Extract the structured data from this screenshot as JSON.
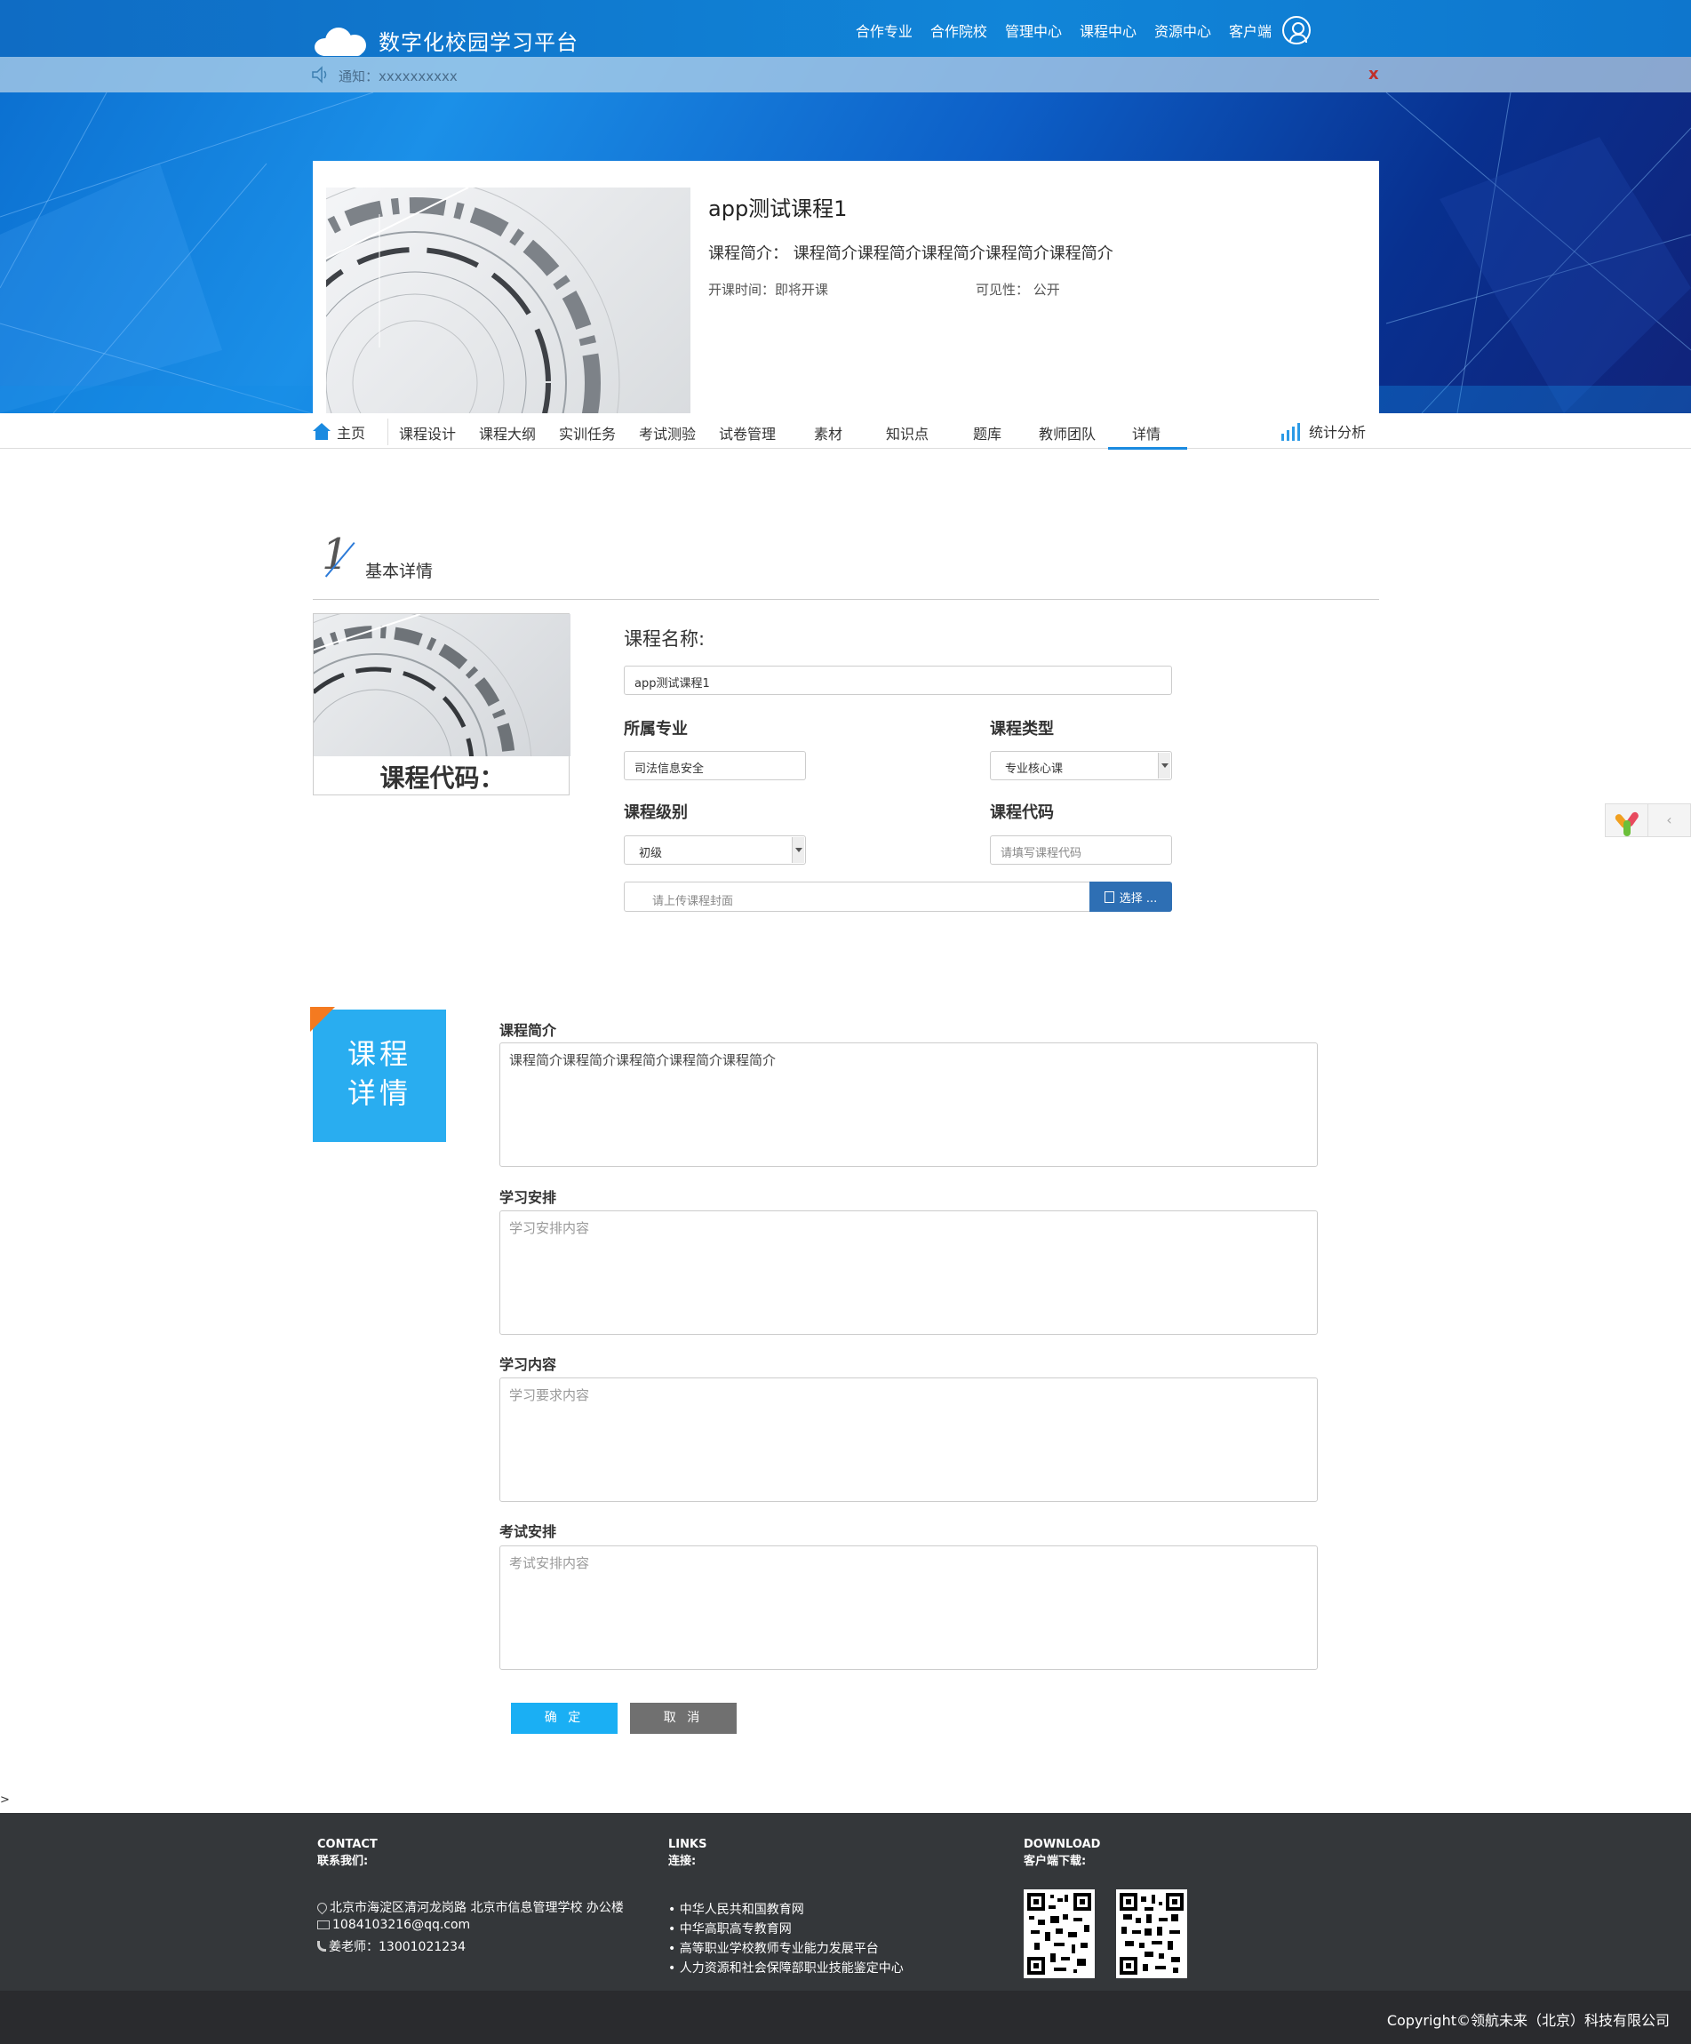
{
  "header": {
    "site_title": "数字化校园学习平台",
    "nav": [
      "合作专业",
      "合作院校",
      "管理中心",
      "课程中心",
      "资源中心",
      "客户端"
    ]
  },
  "notice": {
    "text": "通知：xxxxxxxxxx",
    "close": "x"
  },
  "course": {
    "title": "app测试课程1",
    "intro": "课程简介： 课程简介课程简介课程简介课程简介课程简介",
    "open_time": "开课时间：即将开课",
    "visibility": "可见性： 公开"
  },
  "tabs": {
    "home": "主页",
    "items": [
      "课程设计",
      "课程大纲",
      "实训任务",
      "考试测验",
      "试卷管理",
      "素材",
      "知识点",
      "题库",
      "教师团队",
      "详情"
    ],
    "active": "详情",
    "stats": "统计分析"
  },
  "section1": {
    "number": "1",
    "title": "基本详情",
    "cover_code_label": "课程代码：",
    "course_name_label": "课程名称:",
    "course_name_value": "app测试课程1",
    "major_label": "所属专业",
    "major_value": "司法信息安全",
    "type_label": "课程类型",
    "type_value": "专业核心课",
    "level_label": "课程级别",
    "level_value": "初级",
    "code_label": "课程代码",
    "code_placeholder": "请填写课程代码",
    "upload_placeholder": "请上传课程封面",
    "upload_button": "选择 ..."
  },
  "section2": {
    "badge": [
      "课程",
      "详情"
    ],
    "intro_label": "课程简介",
    "intro_value": "课程简介课程简介课程简介课程简介课程简介",
    "schedule_label": "学习安排",
    "schedule_placeholder": "学习安排内容",
    "content_label": "学习内容",
    "content_placeholder": "学习要求内容",
    "exam_label": "考试安排",
    "exam_placeholder": "考试安排内容",
    "ok": "确 定",
    "cancel": "取 消"
  },
  "stray_char": ">",
  "footer": {
    "contact_en": "CONTACT",
    "contact_cn": "联系我们:",
    "address": "北京市海淀区清河龙岗路 北京市信息管理学校 办公楼",
    "email": "1084103216@qq.com",
    "phone": "姜老师：13001021234",
    "links_en": "LINKS",
    "links_cn": "连接:",
    "links": [
      "• 中华人民共和国教育网",
      "• 中华高职高专教育网",
      "• 高等职业学校教师专业能力发展平台",
      "• 人力资源和社会保障部职业技能鉴定中心"
    ],
    "download_en": "DOWNLOAD",
    "download_cn": "客户端下载:",
    "copyright": "Copyright©领航未来（北京）科技有限公司"
  },
  "colors": {
    "header_blue": "#0f6cc4",
    "accent_blue": "#1a8ae0",
    "badge_blue": "#29adf0",
    "badge_corner": "#f47a20",
    "footer_bg": "#34373a"
  },
  "icons": [
    "cloud-logo-icon",
    "user-icon",
    "speaker-icon",
    "home-icon",
    "stats-icon",
    "folder-icon",
    "location-icon",
    "mail-icon",
    "phone-icon",
    "qr-code-icon"
  ]
}
